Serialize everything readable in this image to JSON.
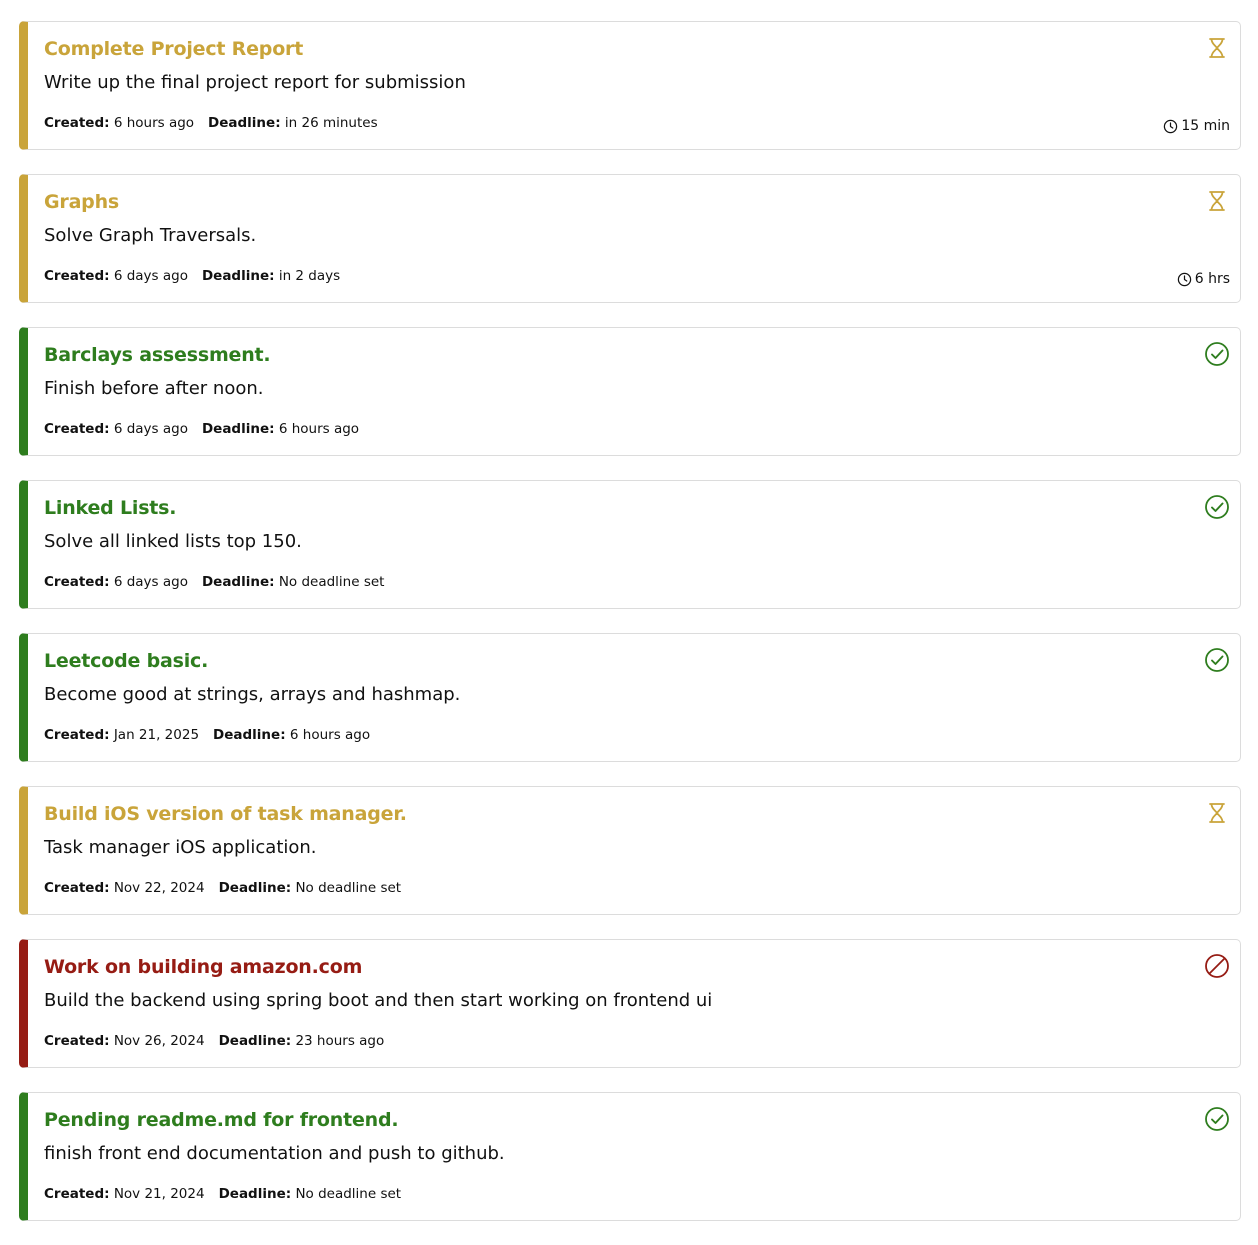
{
  "labels": {
    "created": "Created:",
    "deadline": "Deadline:"
  },
  "colors": {
    "pending": "#c9a43a",
    "completed": "#2e7d1e",
    "cancelled": "#961c14"
  },
  "tasks": [
    {
      "title": "Complete Project Report",
      "description": "Write up the final project report for submission",
      "created": "6 hours ago",
      "deadline": "in 26 minutes",
      "status": "pending",
      "status_icon": "hourglass-icon",
      "time_estimate": "15 min"
    },
    {
      "title": "Graphs",
      "description": "Solve Graph Traversals.",
      "created": "6 days ago",
      "deadline": "in 2 days",
      "status": "pending",
      "status_icon": "hourglass-icon",
      "time_estimate": "6 hrs"
    },
    {
      "title": "Barclays assessment.",
      "description": "Finish before after noon.",
      "created": "6 days ago",
      "deadline": "6 hours ago",
      "status": "completed",
      "status_icon": "check-circle-icon"
    },
    {
      "title": "Linked Lists.",
      "description": "Solve all linked lists top 150.",
      "created": "6 days ago",
      "deadline": "No deadline set",
      "status": "completed",
      "status_icon": "check-circle-icon"
    },
    {
      "title": "Leetcode basic.",
      "description": "Become good at strings, arrays and hashmap.",
      "created": "Jan 21, 2025",
      "deadline": "6 hours ago",
      "status": "completed",
      "status_icon": "check-circle-icon"
    },
    {
      "title": "Build iOS version of task manager.",
      "description": "Task manager iOS application.",
      "created": "Nov 22, 2024",
      "deadline": "No deadline set",
      "status": "pending",
      "status_icon": "hourglass-icon"
    },
    {
      "title": "Work on building amazon.com",
      "description": "Build the backend using spring boot and then start working on frontend ui",
      "created": "Nov 26, 2024",
      "deadline": "23 hours ago",
      "status": "cancelled",
      "status_icon": "ban-icon"
    },
    {
      "title": "Pending readme.md for frontend.",
      "description": "finish front end documentation and push to github.",
      "created": "Nov 21, 2024",
      "deadline": "No deadline set",
      "status": "completed",
      "status_icon": "check-circle-icon"
    }
  ]
}
